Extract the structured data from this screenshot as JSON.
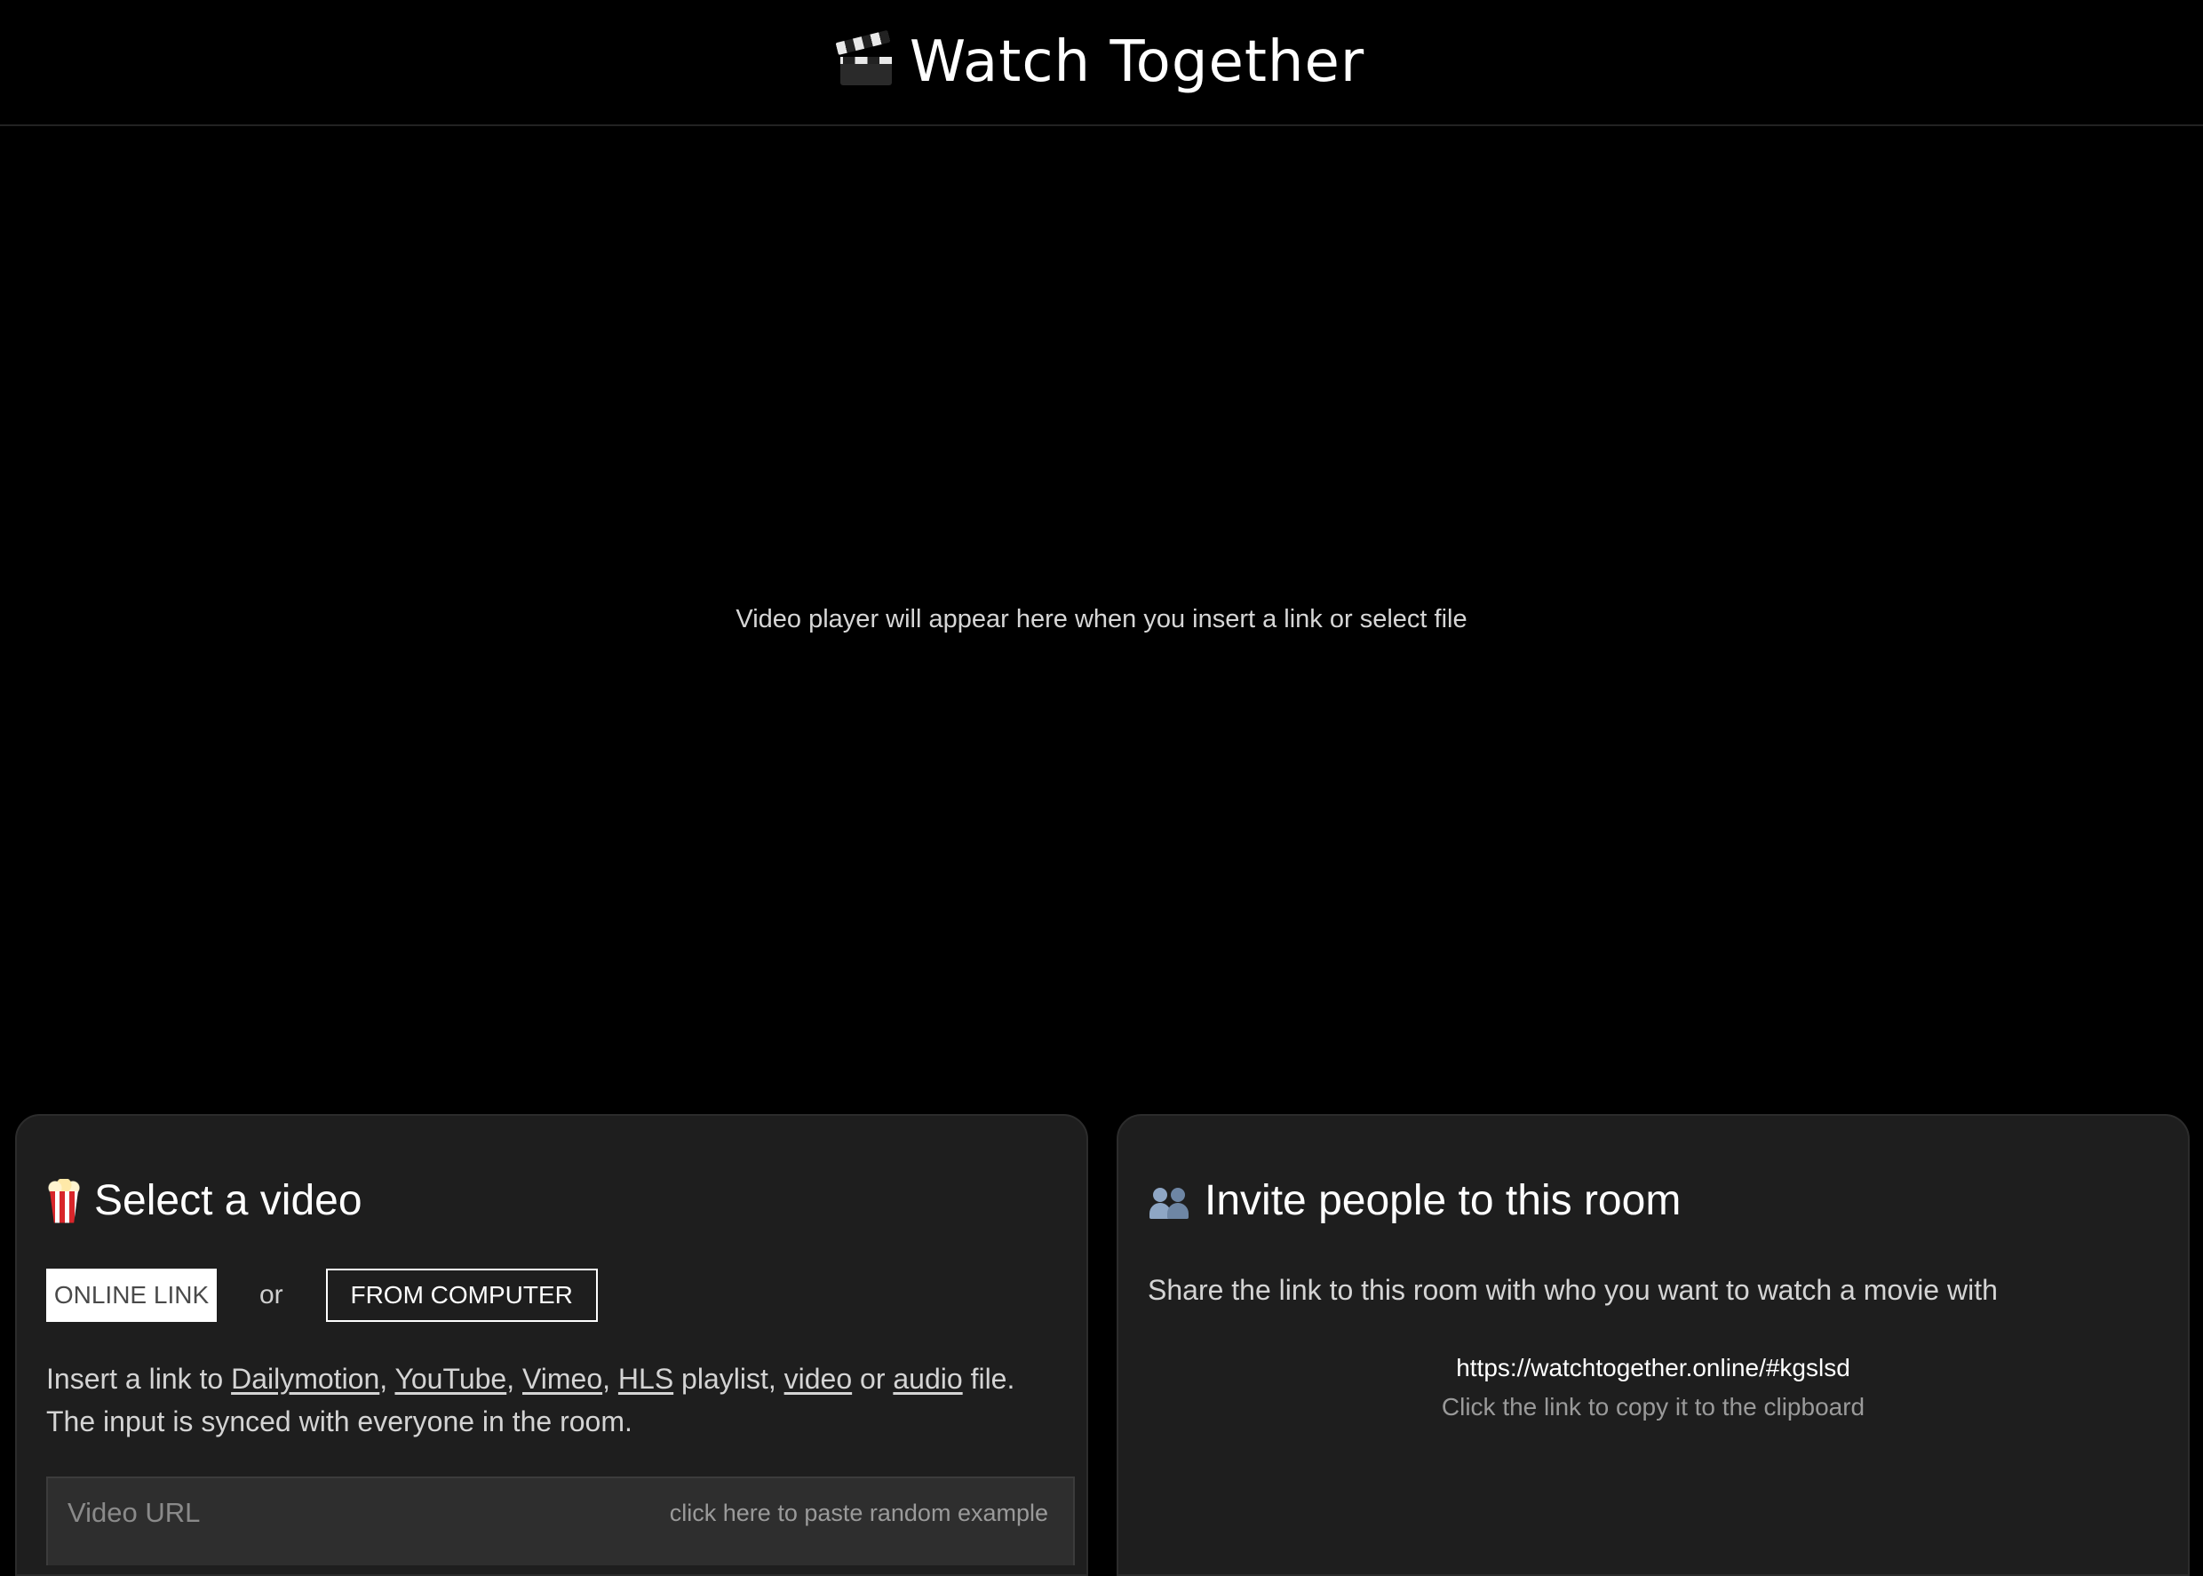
{
  "header": {
    "title": "Watch Together",
    "icon": "clapper-board-icon"
  },
  "player": {
    "placeholder_text": "Video player will appear here when you insert a link or select file"
  },
  "select_panel": {
    "title": "Select a video",
    "icon": "popcorn-icon",
    "tabs": {
      "online_label": "ONLINE LINK",
      "or_label": "or",
      "computer_label": "FROM COMPUTER",
      "active": "ONLINE LINK"
    },
    "description": {
      "prefix": "Insert a link to ",
      "links": [
        "Dailymotion",
        "YouTube",
        "Vimeo",
        "HLS",
        "video",
        "audio"
      ],
      "sep1": ", ",
      "sep2": ", ",
      "sep3": ", ",
      "after_hls": " playlist, ",
      "between_video_audio": " or ",
      "suffix": " file.",
      "line2": "The input is synced with everyone in the room."
    },
    "url_input": {
      "placeholder": "Video URL",
      "value": "",
      "paste_example_label": "click here to paste random example"
    }
  },
  "invite_panel": {
    "title": "Invite people to this room",
    "icon": "people-icon",
    "share_text": "Share the link to this room with who you want to watch a movie with",
    "room_link": "https://watchtogether.online/#kgslsd",
    "copy_hint": "Click the link to copy it to the clipboard"
  },
  "colors": {
    "background": "#000000",
    "panel": "#1e1e1e",
    "text": "#ffffff",
    "muted": "#9a9a9a"
  }
}
